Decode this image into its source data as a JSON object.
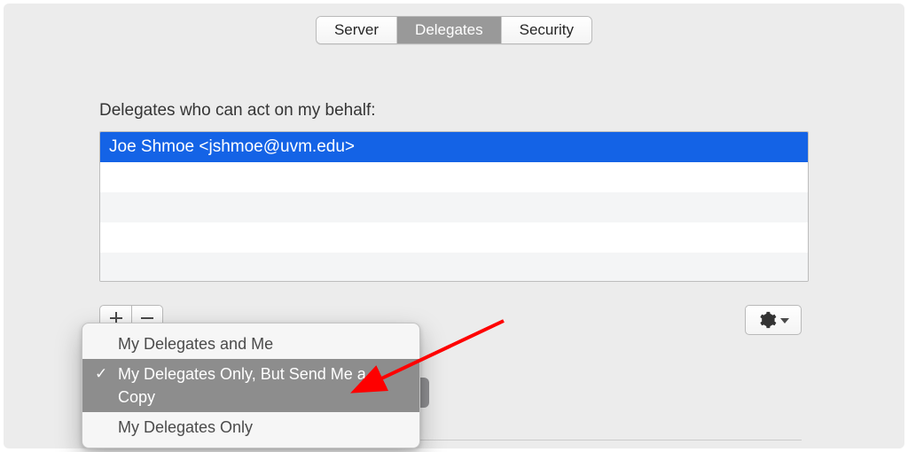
{
  "tabs": {
    "server": "Server",
    "delegates": "Delegates",
    "security": "Security",
    "active": "delegates"
  },
  "section_label": "Delegates who can act on my behalf:",
  "delegates": {
    "rows": [
      "Joe Shmoe <jshmoe@uvm.edu>"
    ],
    "selected_index": 0
  },
  "popup": {
    "items": [
      "My Delegates and Me",
      "My Delegates Only, But Send Me a Copy",
      "My Delegates Only"
    ],
    "selected_index": 1,
    "checkmark": "✓"
  },
  "icons": {
    "gear": "gear-icon",
    "chevron_down": "chevron-down-icon",
    "plus": "plus-icon",
    "minus": "minus-icon"
  },
  "colors": {
    "accent_blue": "#1463e6",
    "arrow_red": "#fe0000"
  }
}
